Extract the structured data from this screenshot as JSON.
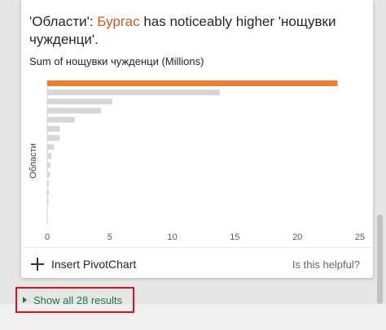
{
  "insight": {
    "title_part1": "'Области': ",
    "title_highlight": "Бургас",
    "title_part2": " has noticeably higher 'нощувки чужденци'."
  },
  "chart_data": {
    "type": "bar",
    "orientation": "horizontal",
    "title": "Sum of нощувки чужденци (Millions)",
    "ylabel": "Области",
    "xlabel": "",
    "xlim": [
      0,
      25
    ],
    "xticks": [
      "0",
      "5",
      "10",
      "15",
      "20",
      "25"
    ],
    "grid": false,
    "category_labels_shown": false,
    "values": [
      23.2,
      13.8,
      5.2,
      4.3,
      2.2,
      1.0,
      1.0,
      0.55,
      0.35,
      0.25,
      0.2,
      0.15,
      0.12,
      0.1
    ],
    "highlight_index": 0,
    "colors": {
      "highlight": "#ed7d31",
      "default": "#d6d6d6",
      "axis": "#d0d0d0",
      "tick_text": "#595959"
    }
  },
  "actions": {
    "insert_label": "Insert PivotChart",
    "helpful_label": "Is this helpful?",
    "show_all_label": "Show all 28 results"
  },
  "icons": {
    "insert": "plus-icon",
    "expand": "triangle-right-icon"
  },
  "colors": {
    "highlight_text": "#d35a1b",
    "link_green": "#217346",
    "annotation_red": "#e0121b"
  }
}
